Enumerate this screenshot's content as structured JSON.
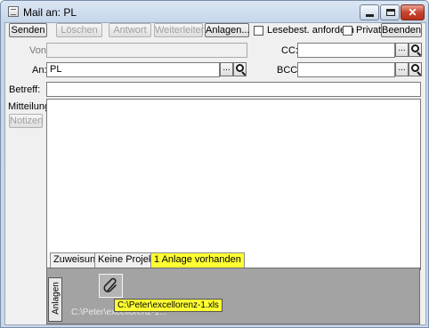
{
  "window": {
    "title": "Mail an: PL"
  },
  "toolbar": {
    "send_label": "Senden",
    "delete_label": "Löschen",
    "reply_label": "Antwort",
    "forward_label": "Weiterleiten",
    "attachments_label": "Anlagen...",
    "read_receipt_label": "Lesebest. anfordern",
    "read_receipt_checked": false,
    "private_label": "Privat",
    "private_checked": false,
    "exit_label": "Beenden"
  },
  "header": {
    "from_label": "Von:",
    "from_value": "",
    "to_label": "An:",
    "to_value": "PL",
    "cc_label": "CC:",
    "cc_value": "",
    "bcc_label": "BCC:",
    "bcc_value": "",
    "subject_label": "Betreff:",
    "subject_value": "",
    "browse_label": "..."
  },
  "body": {
    "message_label": "Mitteilung:",
    "notes_label": "Notizen",
    "message_value": ""
  },
  "tabs": [
    {
      "label": "Zuweisung",
      "selected": false
    },
    {
      "label": "Keine Projekte",
      "selected": false
    },
    {
      "label": "1 Anlage vorhanden",
      "selected": true
    }
  ],
  "attachments": {
    "side_tab_label": "Anlagen",
    "item_caption": "C:\\Peter\\excellorenz-1...",
    "tooltip": "C:\\Peter\\excellorenz-1.xls",
    "icon": "paperclip-icon"
  },
  "colors": {
    "highlight": "#ffff33",
    "attachment_panel": "#a3a3a3"
  }
}
